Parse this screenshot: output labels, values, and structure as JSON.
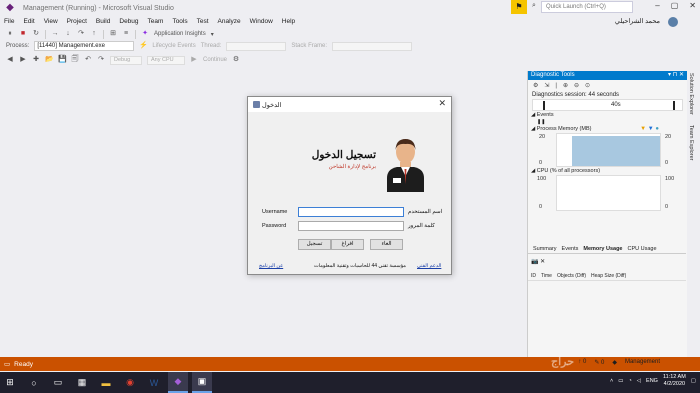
{
  "window": {
    "title": "Management (Running) - Microsoft Visual Studio",
    "quick_launch_placeholder": "Quick Launch (Ctrl+Q)",
    "user_name": "محمد الشراحيلي"
  },
  "menu": [
    "File",
    "Edit",
    "View",
    "Project",
    "Build",
    "Debug",
    "Team",
    "Tools",
    "Test",
    "Analyze",
    "Window",
    "Help"
  ],
  "toolbar": {
    "app_insights_label": "Application Insights",
    "process_label": "Process:",
    "process_value": "[11440] Management.exe",
    "lifecycle_label": "Lifecycle Events",
    "thread_label": "Thread:",
    "stack_frame_label": "Stack Frame:",
    "config_value": "Debug",
    "platform_value": "Any CPU",
    "continue_label": "Continue"
  },
  "dialog": {
    "title": "الدخول",
    "heading": "تسجيل الدخول",
    "subheading": "برنامج لإدارة الشاحن",
    "username_label_en": "Username",
    "password_label_en": "Password",
    "username_label_ar": "اسم المستخدم",
    "password_label_ar": "كلمة المرور",
    "username_value": "",
    "password_value": "",
    "buttons": {
      "login": "تسجيل",
      "clear": "افراغ",
      "cancel": "الغاء"
    },
    "about_link": "عن البرنامج",
    "footer_text": "مؤسسة تقني 44 للحاسبات وتقنية المعلومات",
    "support_link": "الدعم الفني"
  },
  "diagnostics": {
    "title": "Diagnostic Tools",
    "session": "Diagnostics session: 44 seconds",
    "timeline_label": "40s",
    "events_label": "Events",
    "memory_label": "Process Memory (MB)",
    "memory_max": "20",
    "memory_min": "0",
    "memory_max_right": "20",
    "memory_min_right": "0",
    "memory_fill_fraction": 0.95,
    "cpu_label": "CPU (% of all processors)",
    "cpu_max": "100",
    "cpu_min": "0",
    "cpu_max_right": "100",
    "cpu_min_right": "0",
    "tabs": [
      "Summary",
      "Events",
      "Memory Usage",
      "CPU Usage"
    ],
    "table_columns": [
      "ID",
      "Time",
      "Objects (Diff)",
      "Heap Size (Diff)"
    ]
  },
  "side_tabs": [
    "Solution Explorer",
    "Team Explorer"
  ],
  "status": {
    "text": "Ready",
    "project": "Management"
  },
  "taskbar": {
    "lang": "ENG",
    "time": "11:12 AM",
    "date": "4/2/2020"
  },
  "colors": {
    "accent": "#007acc",
    "statusbar": "#ca5100",
    "taskbar": "#1f1f2c"
  }
}
